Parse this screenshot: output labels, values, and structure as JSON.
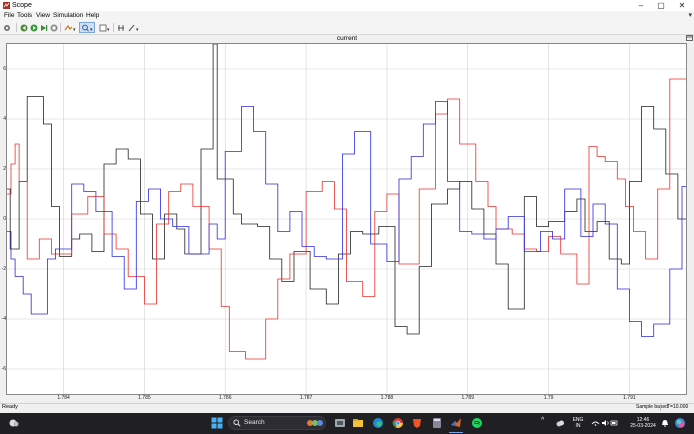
{
  "window": {
    "title": "Scope"
  },
  "menu": {
    "items": [
      "File",
      "Tools",
      "View",
      "Simulation",
      "Help"
    ]
  },
  "toolbar": {
    "icons": [
      "settings-icon",
      "step-back-icon",
      "run-icon",
      "step-forward-icon",
      "stop-icon",
      "highlight-icon",
      "zoom-icon",
      "fit-to-view-icon",
      "cursor-measure-icon",
      "style-icon"
    ]
  },
  "plot": {
    "title": "current",
    "colors": {
      "black": "#222222",
      "red": "#e8302c",
      "blue": "#2a2ae0",
      "grid": "#d2d2d2"
    }
  },
  "chart_data": {
    "type": "line",
    "title": "current",
    "xlabel": "",
    "ylabel": "",
    "xlim": [
      1.7833,
      1.7917
    ],
    "ylim": [
      -7,
      7
    ],
    "xticks": [
      "1.784",
      "1.785",
      "1.786",
      "1.787",
      "1.788",
      "1.789",
      "1.79",
      "1.791"
    ],
    "yticks": [
      "6",
      "4",
      "2",
      "0",
      "-2",
      "-4",
      "-6"
    ],
    "grid": true,
    "series": [
      {
        "color": "#222222",
        "step": true,
        "x": [
          1.7833,
          1.78334,
          1.78345,
          1.78355,
          1.78375,
          1.78385,
          1.78395,
          1.7841,
          1.7842,
          1.78435,
          1.7845,
          1.78465,
          1.7848,
          1.78495,
          1.7851,
          1.78525,
          1.7854,
          1.7855,
          1.7857,
          1.78585,
          1.7859,
          1.7861,
          1.7862,
          1.7864,
          1.78655,
          1.7867,
          1.78685,
          1.78705,
          1.78725,
          1.7874,
          1.78755,
          1.7877,
          1.7879,
          1.7881,
          1.78825,
          1.7884,
          1.78855,
          1.78875,
          1.7889,
          1.78905,
          1.7892,
          1.78935,
          1.7895,
          1.7897,
          1.78985,
          1.79,
          1.7902,
          1.79035,
          1.79045,
          1.7906,
          1.79075,
          1.7909,
          1.791,
          1.79115,
          1.7913,
          1.79145,
          1.7916
        ],
        "y": [
          1.2,
          -1.2,
          1.5,
          4.9,
          3.8,
          0.5,
          -1.5,
          -0.8,
          -0.6,
          -1.3,
          2.2,
          2.8,
          2.4,
          0.2,
          -1.6,
          0.2,
          -0.4,
          -1.4,
          2.8,
          7,
          1.6,
          0.2,
          -0.2,
          -0.3,
          -1.6,
          -2.5,
          -1.3,
          -2.8,
          -3.4,
          -1.4,
          -0.5,
          -0.6,
          -0.3,
          -4.3,
          -4.6,
          -1.9,
          0.6,
          1.2,
          1.5,
          0.4,
          -0.6,
          -1.8,
          -3.6,
          0.9,
          -0.3,
          -0.1,
          0.3,
          0.8,
          -0.5,
          -0.1,
          -1.6,
          -1.8,
          1.5,
          4.5,
          3.6,
          1.8,
          0
        ]
      },
      {
        "color": "#e8302c",
        "step": true,
        "x": [
          1.7833,
          1.78335,
          1.7834,
          1.78345,
          1.78355,
          1.7837,
          1.78385,
          1.7841,
          1.7843,
          1.7845,
          1.78465,
          1.7848,
          1.785,
          1.78515,
          1.7853,
          1.78545,
          1.7856,
          1.7858,
          1.78595,
          1.78605,
          1.78625,
          1.7865,
          1.78665,
          1.7868,
          1.787,
          1.7872,
          1.78735,
          1.7875,
          1.7877,
          1.78785,
          1.788,
          1.78815,
          1.7884,
          1.7886,
          1.78875,
          1.7889,
          1.7891,
          1.78925,
          1.78935,
          1.78955,
          1.7897,
          1.78985,
          1.79,
          1.79015,
          1.79035,
          1.7905,
          1.7906,
          1.7907,
          1.79085,
          1.79095,
          1.79105,
          1.7912,
          1.79135,
          1.7915
        ],
        "y": [
          1,
          2.2,
          3,
          1.5,
          -1.6,
          -0.8,
          -1.4,
          0.2,
          0.9,
          -0.6,
          -1.2,
          -2.3,
          -3.4,
          -0.2,
          1.1,
          1.4,
          0.5,
          -1.2,
          -3.5,
          -5.3,
          -5.6,
          -4,
          -2.4,
          -1.4,
          1.1,
          1.5,
          0.4,
          -2.5,
          -3.1,
          0.3,
          1,
          -1.8,
          1.2,
          4.2,
          4.8,
          3,
          1.5,
          0.5,
          -0.4,
          -0.6,
          -1.2,
          -1.3,
          -0.7,
          -1.4,
          -2.6,
          2.9,
          2.5,
          2.3,
          1.6,
          0.5,
          -0.5,
          -1.6,
          1.2,
          5.6
        ]
      },
      {
        "color": "#2a2ae0",
        "step": true,
        "x": [
          1.7833,
          1.78335,
          1.7834,
          1.7835,
          1.7836,
          1.7838,
          1.7839,
          1.7841,
          1.78425,
          1.7844,
          1.7846,
          1.78475,
          1.7849,
          1.78505,
          1.7852,
          1.78535,
          1.78555,
          1.7858,
          1.7859,
          1.786,
          1.7862,
          1.78635,
          1.7865,
          1.78665,
          1.7868,
          1.78695,
          1.7871,
          1.78725,
          1.78745,
          1.7876,
          1.7878,
          1.788,
          1.78815,
          1.7883,
          1.78845,
          1.7886,
          1.78875,
          1.7889,
          1.78905,
          1.7892,
          1.78935,
          1.7895,
          1.7897,
          1.7899,
          1.79005,
          1.7902,
          1.7904,
          1.79055,
          1.7907,
          1.79085,
          1.791,
          1.79115,
          1.7913,
          1.7915,
          1.79165
        ],
        "y": [
          -0.5,
          -1.6,
          -2.3,
          -3,
          -3.8,
          -1.6,
          -1.2,
          1.4,
          1.1,
          0.3,
          -1.5,
          -2.8,
          0.7,
          1.2,
          0,
          -0.3,
          -1.4,
          -0.2,
          -0.8,
          2.7,
          4.5,
          3.5,
          1.4,
          -0.5,
          0.3,
          -1.1,
          -1.5,
          -1.6,
          2.6,
          3.5,
          -1,
          -1.7,
          1.6,
          2.5,
          3.8,
          4.7,
          1.5,
          -0.5,
          -0.6,
          -0.8,
          -0.4,
          0.1,
          -1.3,
          -0.5,
          -0.8,
          1.2,
          -0.7,
          0.6,
          -0.2,
          -2.8,
          -4.1,
          -4.7,
          -4.2,
          -2,
          1.3
        ]
      }
    ]
  },
  "status": {
    "left": "Ready",
    "sample": "Sample based",
    "time": "T=10.000"
  },
  "taskbar": {
    "search_label": "Search",
    "lang_top": "ENG",
    "lang_bottom": "IN",
    "clock_time": "12:46",
    "clock_date": "25-03-2024"
  }
}
